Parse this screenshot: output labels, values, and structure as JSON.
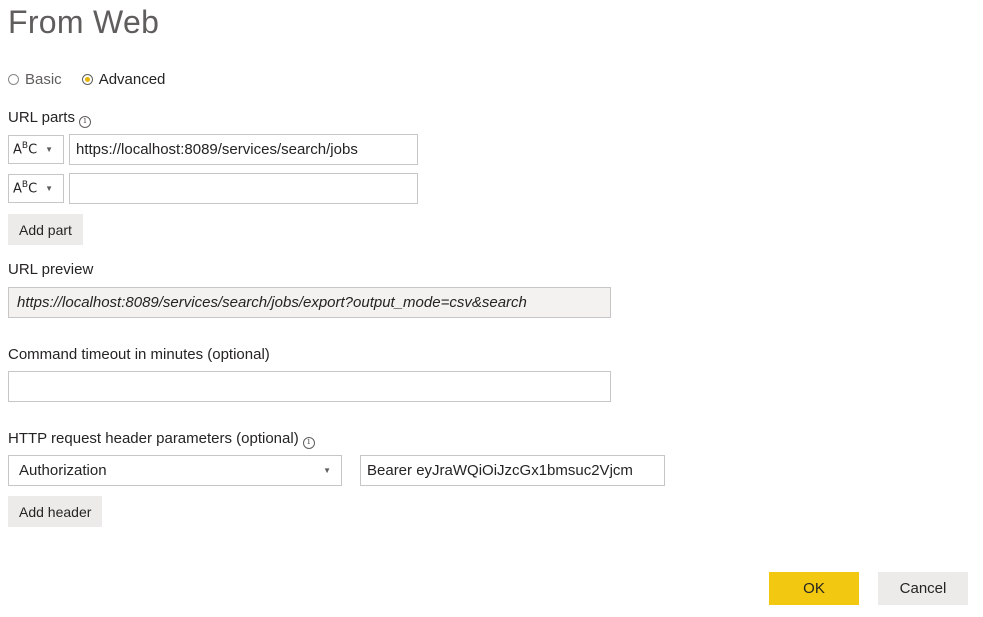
{
  "dialog": {
    "title": "From Web"
  },
  "mode": {
    "options": [
      {
        "label": "Basic",
        "selected": false
      },
      {
        "label": "Advanced",
        "selected": true
      }
    ]
  },
  "url_parts": {
    "label": "URL parts",
    "info_icon": "i",
    "type_icon_text": "ABC",
    "parts": [
      {
        "type": "ABC",
        "value": "https://localhost:8089/services/search/jobs"
      },
      {
        "type": "ABC",
        "value": ""
      }
    ],
    "add_part_label": "Add part"
  },
  "url_preview": {
    "label": "URL preview",
    "value": "https://localhost:8089/services/search/jobs/export?output_mode=csv&search"
  },
  "timeout": {
    "label": "Command timeout in minutes (optional)",
    "value": ""
  },
  "headers": {
    "label": "HTTP request header parameters (optional)",
    "info_icon": "i",
    "name_selected": "Authorization",
    "value": "Bearer eyJraWQiOiJzcGx1bmsuc2Vjcm",
    "add_header_label": "Add header"
  },
  "footer": {
    "ok_label": "OK",
    "cancel_label": "Cancel"
  },
  "colors": {
    "accent": "#f2c811",
    "radio_dot": "#e8b400",
    "button_grey": "#edebe9"
  }
}
